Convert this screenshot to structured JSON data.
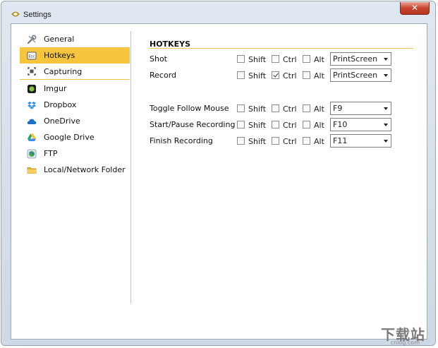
{
  "window": {
    "title": "Settings",
    "close_label": "✕"
  },
  "sidebar": {
    "items": [
      {
        "label": "General",
        "icon": "tools-icon",
        "active": false
      },
      {
        "label": "Hotkeys",
        "icon": "keyboard-key-icon",
        "active": true
      },
      {
        "label": "Capturing",
        "icon": "capture-frame-icon",
        "active": false
      },
      {
        "label": "Imgur",
        "icon": "imgur-icon",
        "active": false
      },
      {
        "label": "Dropbox",
        "icon": "dropbox-icon",
        "active": false
      },
      {
        "label": "OneDrive",
        "icon": "onedrive-cloud-icon",
        "active": false
      },
      {
        "label": "Google Drive",
        "icon": "google-drive-icon",
        "active": false
      },
      {
        "label": "FTP",
        "icon": "ftp-globe-icon",
        "active": false
      },
      {
        "label": "Local/Network Folder",
        "icon": "folder-icon",
        "active": false
      }
    ]
  },
  "hotkeys": {
    "section_title": "HOTKEYS",
    "modifiers": {
      "shift": "Shift",
      "ctrl": "Ctrl",
      "alt": "Alt"
    },
    "rows": [
      {
        "label": "Shot",
        "shift": false,
        "ctrl": false,
        "alt": false,
        "key": "PrintScreen"
      },
      {
        "label": "Record",
        "shift": false,
        "ctrl": true,
        "alt": false,
        "key": "PrintScreen"
      },
      {
        "label": "Toggle Follow Mouse",
        "shift": false,
        "ctrl": false,
        "alt": false,
        "key": "F9"
      },
      {
        "label": "Start/Pause Recording",
        "shift": false,
        "ctrl": false,
        "alt": false,
        "key": "F10"
      },
      {
        "label": "Finish Recording",
        "shift": false,
        "ctrl": false,
        "alt": false,
        "key": "F11"
      }
    ]
  },
  "watermark": {
    "text": "下载站",
    "sub": "cnlog.com"
  },
  "colors": {
    "accent": "#f7c43d",
    "divider": "#f2c44a",
    "close": "#c9442e"
  }
}
